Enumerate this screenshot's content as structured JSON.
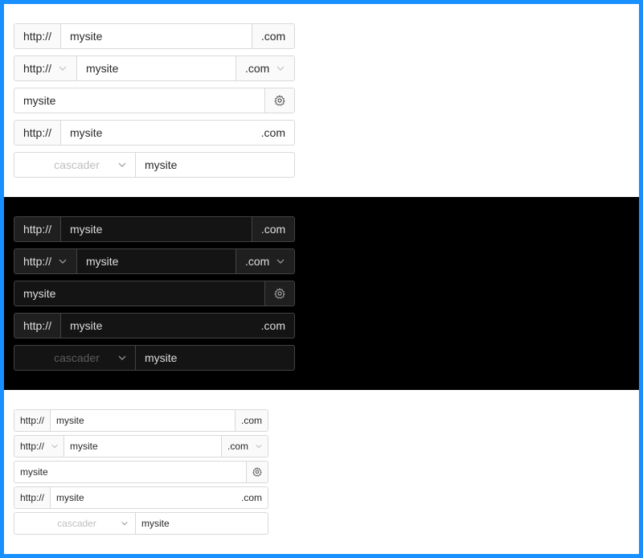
{
  "colors": {
    "accent": "#1890ff",
    "dark_bg": "#000000",
    "light_bg": "#ffffff"
  },
  "sections": [
    {
      "rows": [
        {
          "addon_before": "http://",
          "value": "mysite",
          "addon_after": ".com"
        },
        {
          "select_before": "http://",
          "value": "mysite",
          "select_after": ".com"
        },
        {
          "value": "mysite",
          "icon": "gear-icon"
        },
        {
          "addon_before": "http://",
          "value": "mysite",
          "suffix": ".com"
        },
        {
          "cascader_placeholder": "cascader",
          "value": "mysite"
        }
      ]
    },
    {
      "rows": [
        {
          "addon_before": "http://",
          "value": "mysite",
          "addon_after": ".com"
        },
        {
          "select_before": "http://",
          "value": "mysite",
          "select_after": ".com"
        },
        {
          "value": "mysite",
          "icon": "gear-icon"
        },
        {
          "addon_before": "http://",
          "value": "mysite",
          "suffix": ".com"
        },
        {
          "cascader_placeholder": "cascader",
          "value": "mysite"
        }
      ]
    },
    {
      "rows": [
        {
          "addon_before": "http://",
          "value": "mysite",
          "addon_after": ".com"
        },
        {
          "select_before": "http://",
          "value": "mysite",
          "select_after": ".com"
        },
        {
          "value": "mysite",
          "icon": "gear-icon"
        },
        {
          "addon_before": "http://",
          "value": "mysite",
          "suffix": ".com"
        },
        {
          "cascader_placeholder": "cascader",
          "value": "mysite"
        }
      ]
    }
  ]
}
